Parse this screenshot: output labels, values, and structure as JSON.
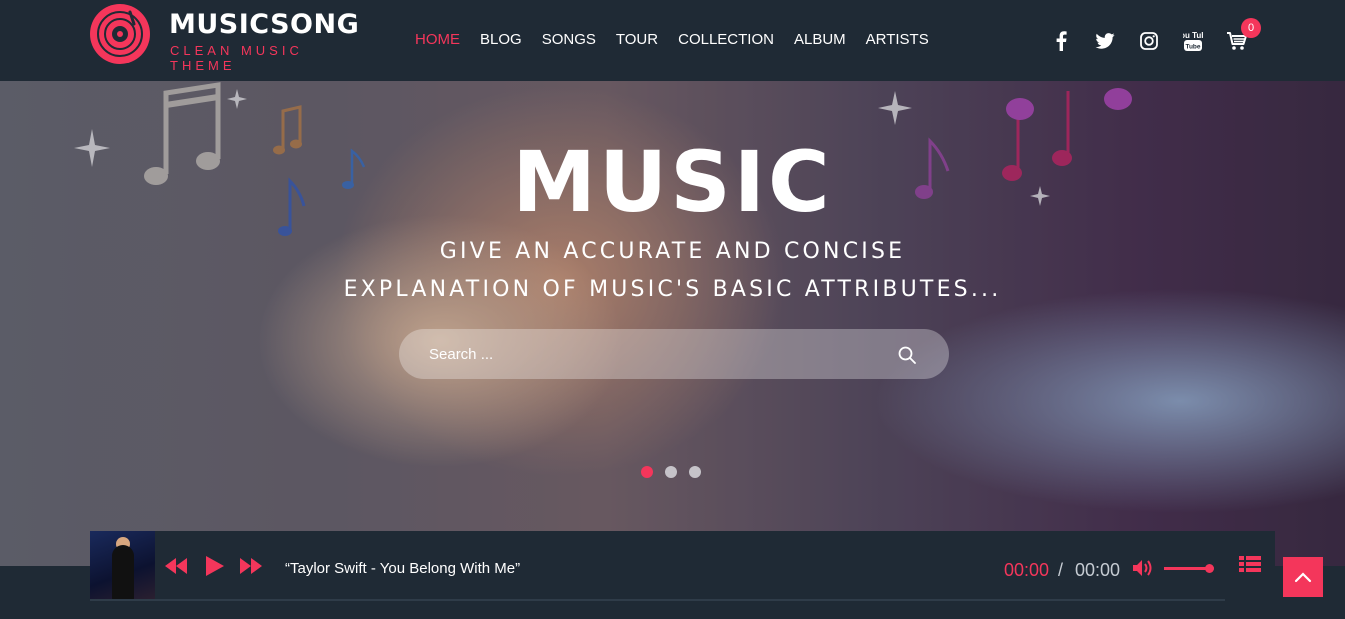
{
  "brand": {
    "name": "MUSICSONG",
    "tagline": "CLEAN MUSIC THEME",
    "accent": "#f4365b",
    "header_bg": "#1f2a35"
  },
  "nav": {
    "items": [
      {
        "label": "HOME",
        "active": true
      },
      {
        "label": "BLOG"
      },
      {
        "label": "SONGS"
      },
      {
        "label": "TOUR"
      },
      {
        "label": "COLLECTION"
      },
      {
        "label": "ALBUM"
      },
      {
        "label": "ARTISTS"
      }
    ]
  },
  "social": {
    "icons": [
      "facebook-icon",
      "twitter-icon",
      "instagram-icon",
      "youtube-icon",
      "cart-icon"
    ],
    "youtube_text": "You Tube",
    "cart_count": "0"
  },
  "hero": {
    "title": "MUSIC",
    "subtitle_line1": "GIVE AN ACCURATE AND CONCISE",
    "subtitle_line2": "EXPLANATION OF MUSIC'S BASIC ATTRIBUTES...",
    "search_placeholder": "Search ...",
    "slides": 3,
    "active_slide": 1
  },
  "player": {
    "track": "“Taylor Swift - You Belong With Me”",
    "current_time": "00:00",
    "separator": "/",
    "total_time": "00:00",
    "volume": 0.9,
    "icons": [
      "rewind-icon",
      "play-icon",
      "fast-forward-icon",
      "volume-icon",
      "playlist-icon"
    ]
  },
  "scroll_top": {
    "icon": "chevron-up-icon"
  }
}
